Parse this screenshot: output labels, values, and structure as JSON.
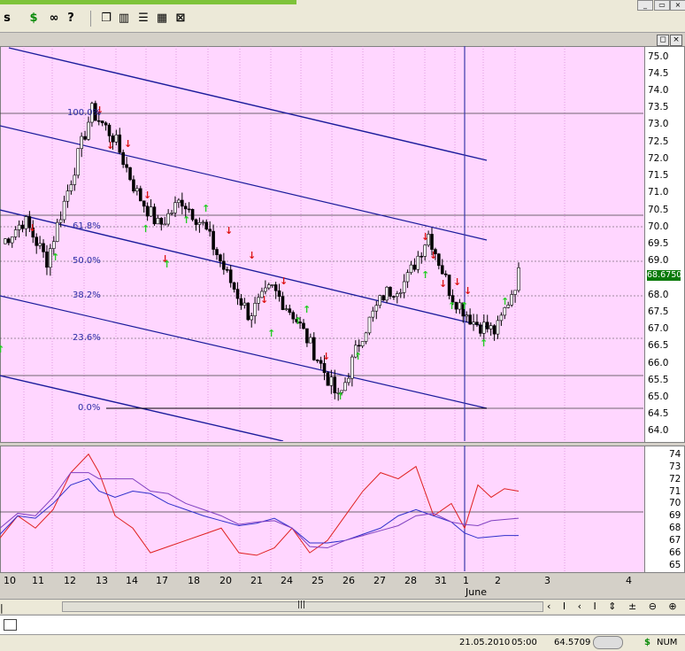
{
  "toolbar": {
    "dollar_icon": "$",
    "binoculars_icon": "binoculars",
    "help_icon": "?",
    "window_minimize": "_",
    "window_restore": "▭",
    "window_close": "×"
  },
  "chart_panel": {
    "restore_icon": "◻",
    "close_icon": "×"
  },
  "price_axis": {
    "labels": [
      "75.0",
      "74.5",
      "74.0",
      "73.5",
      "73.0",
      "72.5",
      "72.0",
      "71.5",
      "71.0",
      "70.5",
      "70.0",
      "69.5",
      "69.0",
      "68.5",
      "68.0",
      "67.5",
      "67.0",
      "66.5",
      "66.0",
      "65.5",
      "65.0",
      "64.5",
      "64.0"
    ],
    "current_price": "68.6750"
  },
  "fib_levels": [
    "100.0%",
    "61.8%",
    "50.0%",
    "38.2%",
    "23.6%",
    "0.0%"
  ],
  "oscillator_axis": {
    "labels": [
      "74",
      "73",
      "72",
      "71",
      "70",
      "69",
      "68",
      "67",
      "66",
      "65"
    ]
  },
  "time_axis": {
    "labels": [
      "10",
      "11",
      "12",
      "13",
      "14",
      "17",
      "18",
      "20",
      "21",
      "24",
      "25",
      "26",
      "27",
      "28",
      "31",
      "1",
      "2",
      "3",
      "4"
    ],
    "month_label": "June"
  },
  "status_bar": {
    "date": "21.05.2010",
    "time": "05:00",
    "value": "64.5709",
    "dollar": "$",
    "num": "NUM"
  },
  "colors": {
    "chart_bg": "#ffd6ff",
    "channel_line": "#1c1c9c",
    "up_arrow": "#22cc22",
    "down_arrow": "#dd1111",
    "osc_red": "#e02020",
    "osc_blue": "#3030cc",
    "osc_purple": "#8040c0"
  },
  "chart_data": {
    "type": "line",
    "x": [
      "10",
      "11",
      "12",
      "13",
      "14",
      "17",
      "18",
      "20",
      "21",
      "24",
      "25",
      "26",
      "27",
      "28",
      "31",
      "1",
      "2"
    ],
    "series": [
      {
        "values": [
          69.5,
          70.2,
          69.0,
          71.2,
          73.4,
          72.6,
          71.0,
          70.0,
          70.8,
          70.0,
          68.6,
          67.4,
          68.2,
          67.4,
          66.2,
          64.9,
          66.8,
          68.0,
          68.4,
          69.8,
          68.0,
          67.2,
          66.9,
          68.6
        ]
      }
    ],
    "ylim": [
      63.7,
      75.3
    ],
    "osc_ylim": [
      64.5,
      74.7
    ]
  }
}
